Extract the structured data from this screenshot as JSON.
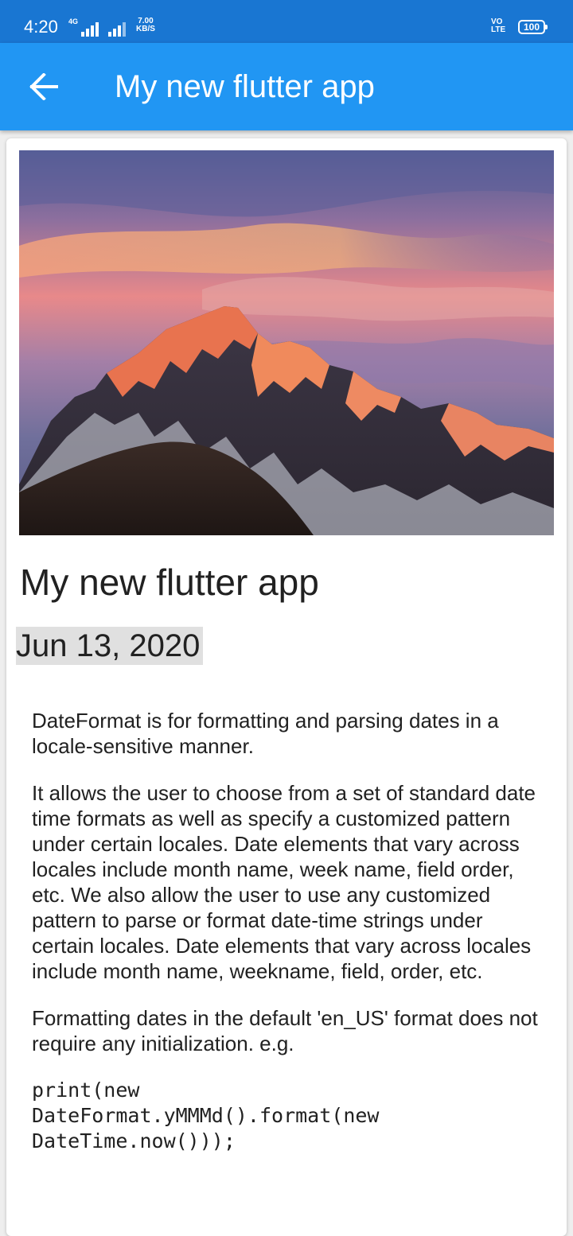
{
  "status_bar": {
    "time": "4:20",
    "network_label": "4G",
    "speed_value": "7.00",
    "speed_unit": "KB/S",
    "volte_line1": "VO",
    "volte_line2": "LTE",
    "battery": "100"
  },
  "app_bar": {
    "back_icon": "arrow-back-icon",
    "title": "My new flutter app"
  },
  "article": {
    "image_subject": "mountain sunset",
    "title": "My new flutter app",
    "date": "Jun 13, 2020",
    "paragraphs": [
      "DateFormat is for formatting and parsing dates in a locale-sensitive manner.",
      "It allows the user to choose from a set of standard date time formats as well as specify a customized pattern under certain locales. Date elements that vary across locales include month name, week name, field order, etc. We also allow the user to use any customized pattern to parse or format date-time strings under certain locales. Date elements that vary across locales include month name, weekname, field, order, etc.",
      "Formatting dates in the default 'en_US' format does not require any initialization. e.g."
    ],
    "code": "print(new\nDateFormat.yMMMd().format(new\nDateTime.now()));"
  },
  "colors": {
    "status_bar": "#1976d2",
    "app_bar": "#2196f3",
    "date_highlight": "#e0e0e0"
  }
}
